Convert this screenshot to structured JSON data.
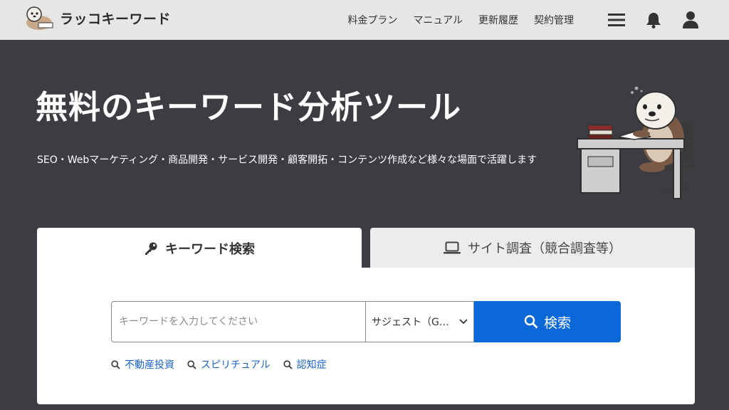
{
  "header": {
    "logo_text": "ラッコキーワード",
    "nav": [
      "料金プラン",
      "マニュアル",
      "更新履歴",
      "契約管理"
    ],
    "icons": [
      "menu-icon",
      "bell-icon",
      "user-icon"
    ]
  },
  "hero": {
    "title": "無料のキーワード分析ツール",
    "subtitle": "SEO・Webマーケティング・商品開発・サービス開発・顧客開拓・コンテンツ作成など様々な場面で活躍します"
  },
  "tabs": [
    {
      "label": "キーワード検索",
      "icon": "key-icon",
      "active": true
    },
    {
      "label": "サイト調査（競合調査等）",
      "icon": "laptop-icon",
      "active": false
    }
  ],
  "search": {
    "placeholder": "キーワードを入力してください",
    "select_value": "サジェスト（G…",
    "button_label": "検索"
  },
  "suggestions": [
    "不動産投資",
    "スピリチュアル",
    "認知症"
  ],
  "colors": {
    "accent": "#0a68d9",
    "link": "#1a64c8",
    "background": "#3d3c42",
    "header": "#e6e6e6"
  }
}
